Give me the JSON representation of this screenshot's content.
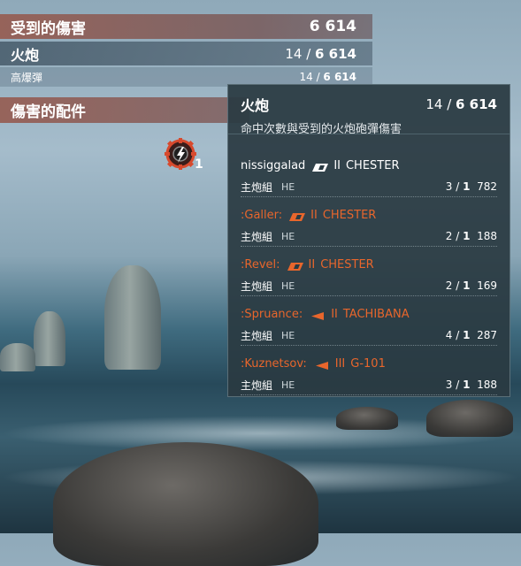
{
  "stats": {
    "received_label": "受到的傷害",
    "received_value": "6 614",
    "guns_label": "火炮",
    "guns_hits": "14",
    "guns_damage": "6 614",
    "he_label": "高爆彈",
    "he_hits": "14",
    "he_damage": "6 614",
    "modules_label": "傷害的配件",
    "module_count": "1"
  },
  "tooltip": {
    "title": "火炮",
    "total_hits": "14",
    "total_damage": "6 614",
    "subtitle": "命中次數與受到的火炮砲彈傷害",
    "entries": [
      {
        "player": "nissiggalad",
        "tier": "II",
        "ship": "CHESTER",
        "weapon": "主炮組",
        "ammo": "HE",
        "hits": "3",
        "count": "1",
        "damage": "782",
        "team": "ally"
      },
      {
        "player": ":Galler:",
        "tier": "II",
        "ship": "CHESTER",
        "weapon": "主炮組",
        "ammo": "HE",
        "hits": "2",
        "count": "1",
        "damage": "188",
        "team": "enemy"
      },
      {
        "player": ":Revel:",
        "tier": "II",
        "ship": "CHESTER",
        "weapon": "主炮組",
        "ammo": "HE",
        "hits": "2",
        "count": "1",
        "damage": "169",
        "team": "enemy"
      },
      {
        "player": ":Spruance:",
        "tier": "II",
        "ship": "TACHIBANA",
        "weapon": "主炮組",
        "ammo": "HE",
        "hits": "4",
        "count": "1",
        "damage": "287",
        "team": "enemy"
      },
      {
        "player": ":Kuznetsov:",
        "tier": "III",
        "ship": "G-101",
        "weapon": "主炮組",
        "ammo": "HE",
        "hits": "3",
        "count": "1",
        "damage": "188",
        "team": "enemy"
      }
    ]
  },
  "colors": {
    "ally": "#ffffff",
    "enemy": "#e8662c",
    "header_bar": "#965f55"
  },
  "icons": {
    "module": "gear-lightning-icon",
    "cruiser": "cruiser-ship-icon",
    "destroyer": "destroyer-ship-icon"
  }
}
